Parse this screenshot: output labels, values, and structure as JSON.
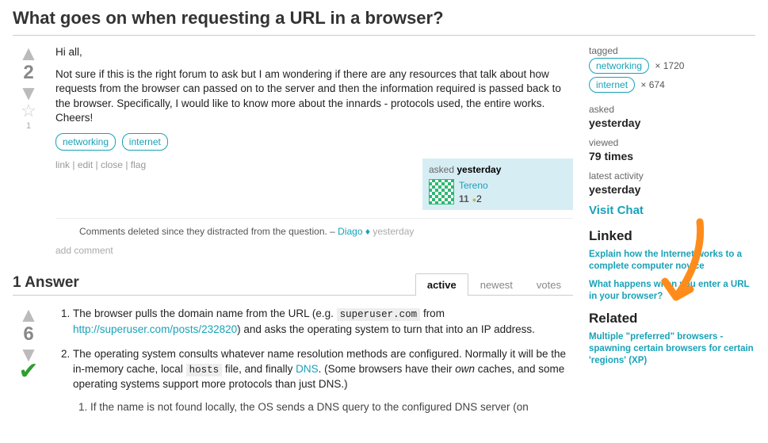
{
  "title": "What goes on when requesting a URL in a browser?",
  "question": {
    "score": "2",
    "fav_count": "1",
    "body1": "Hi all,",
    "body2": "Not sure if this is the right forum to ask but I am wondering if there are any resources that talk about how requests from the browser can passed on to the server and then the information required is passed back to the browser. Specifically, I would like to know more about the innards - protocols used, the entire works. Cheers!",
    "tags": [
      "networking",
      "internet"
    ],
    "menu": {
      "link": "link",
      "edit": "edit",
      "close": "close",
      "flag": "flag"
    },
    "sig": {
      "label": "asked ",
      "when": "yesterday",
      "user": "Tereno",
      "rep": "11",
      "badge": "2"
    },
    "comment": {
      "text": "Comments deleted since they distracted from the question. – ",
      "user": "Diago",
      "when": "yesterday"
    },
    "add_comment": "add comment"
  },
  "answers": {
    "header": "1 Answer",
    "tabs": {
      "active": "active",
      "newest": "newest",
      "votes": "votes"
    },
    "answer": {
      "score": "6",
      "item1a": "The browser pulls the domain name from the URL (e.g. ",
      "item1code": "superuser.com",
      "item1b": " from ",
      "item1link": "http://superuser.com/posts/232820",
      "item1c": ") and asks the operating system to turn that into an IP address.",
      "item2a": "The operating system consults whatever name resolution methods are configured. Normally it will be the in-memory cache, local ",
      "item2code1": "hosts",
      "item2b": " file, and finally ",
      "item2link": "DNS",
      "item2c": ". (Some browsers have their ",
      "item2i": "own",
      "item2d": " caches, and some operating systems support more protocols than just DNS.)",
      "item2sub": "If the name is not found locally, the OS sends a DNS query to the configured DNS server (on"
    }
  },
  "sidebar": {
    "tagged_label": "tagged",
    "tag_rows": [
      {
        "tag": "networking",
        "count": "× 1720"
      },
      {
        "tag": "internet",
        "count": "× 674"
      }
    ],
    "asked_label": "asked",
    "asked_val": "yesterday",
    "viewed_label": "viewed",
    "viewed_val": "79 times",
    "latest_label": "latest activity",
    "latest_val": "yesterday",
    "visit_chat": "Visit Chat",
    "linked_h": "Linked",
    "linked": [
      "Explain how the Internet works to a complete computer novice",
      "What happens when you enter a URL in your browser?"
    ],
    "related_h": "Related",
    "related": [
      "Multiple \"preferred\" browsers - spawning certain browsers for certain 'regions' (XP)"
    ]
  }
}
